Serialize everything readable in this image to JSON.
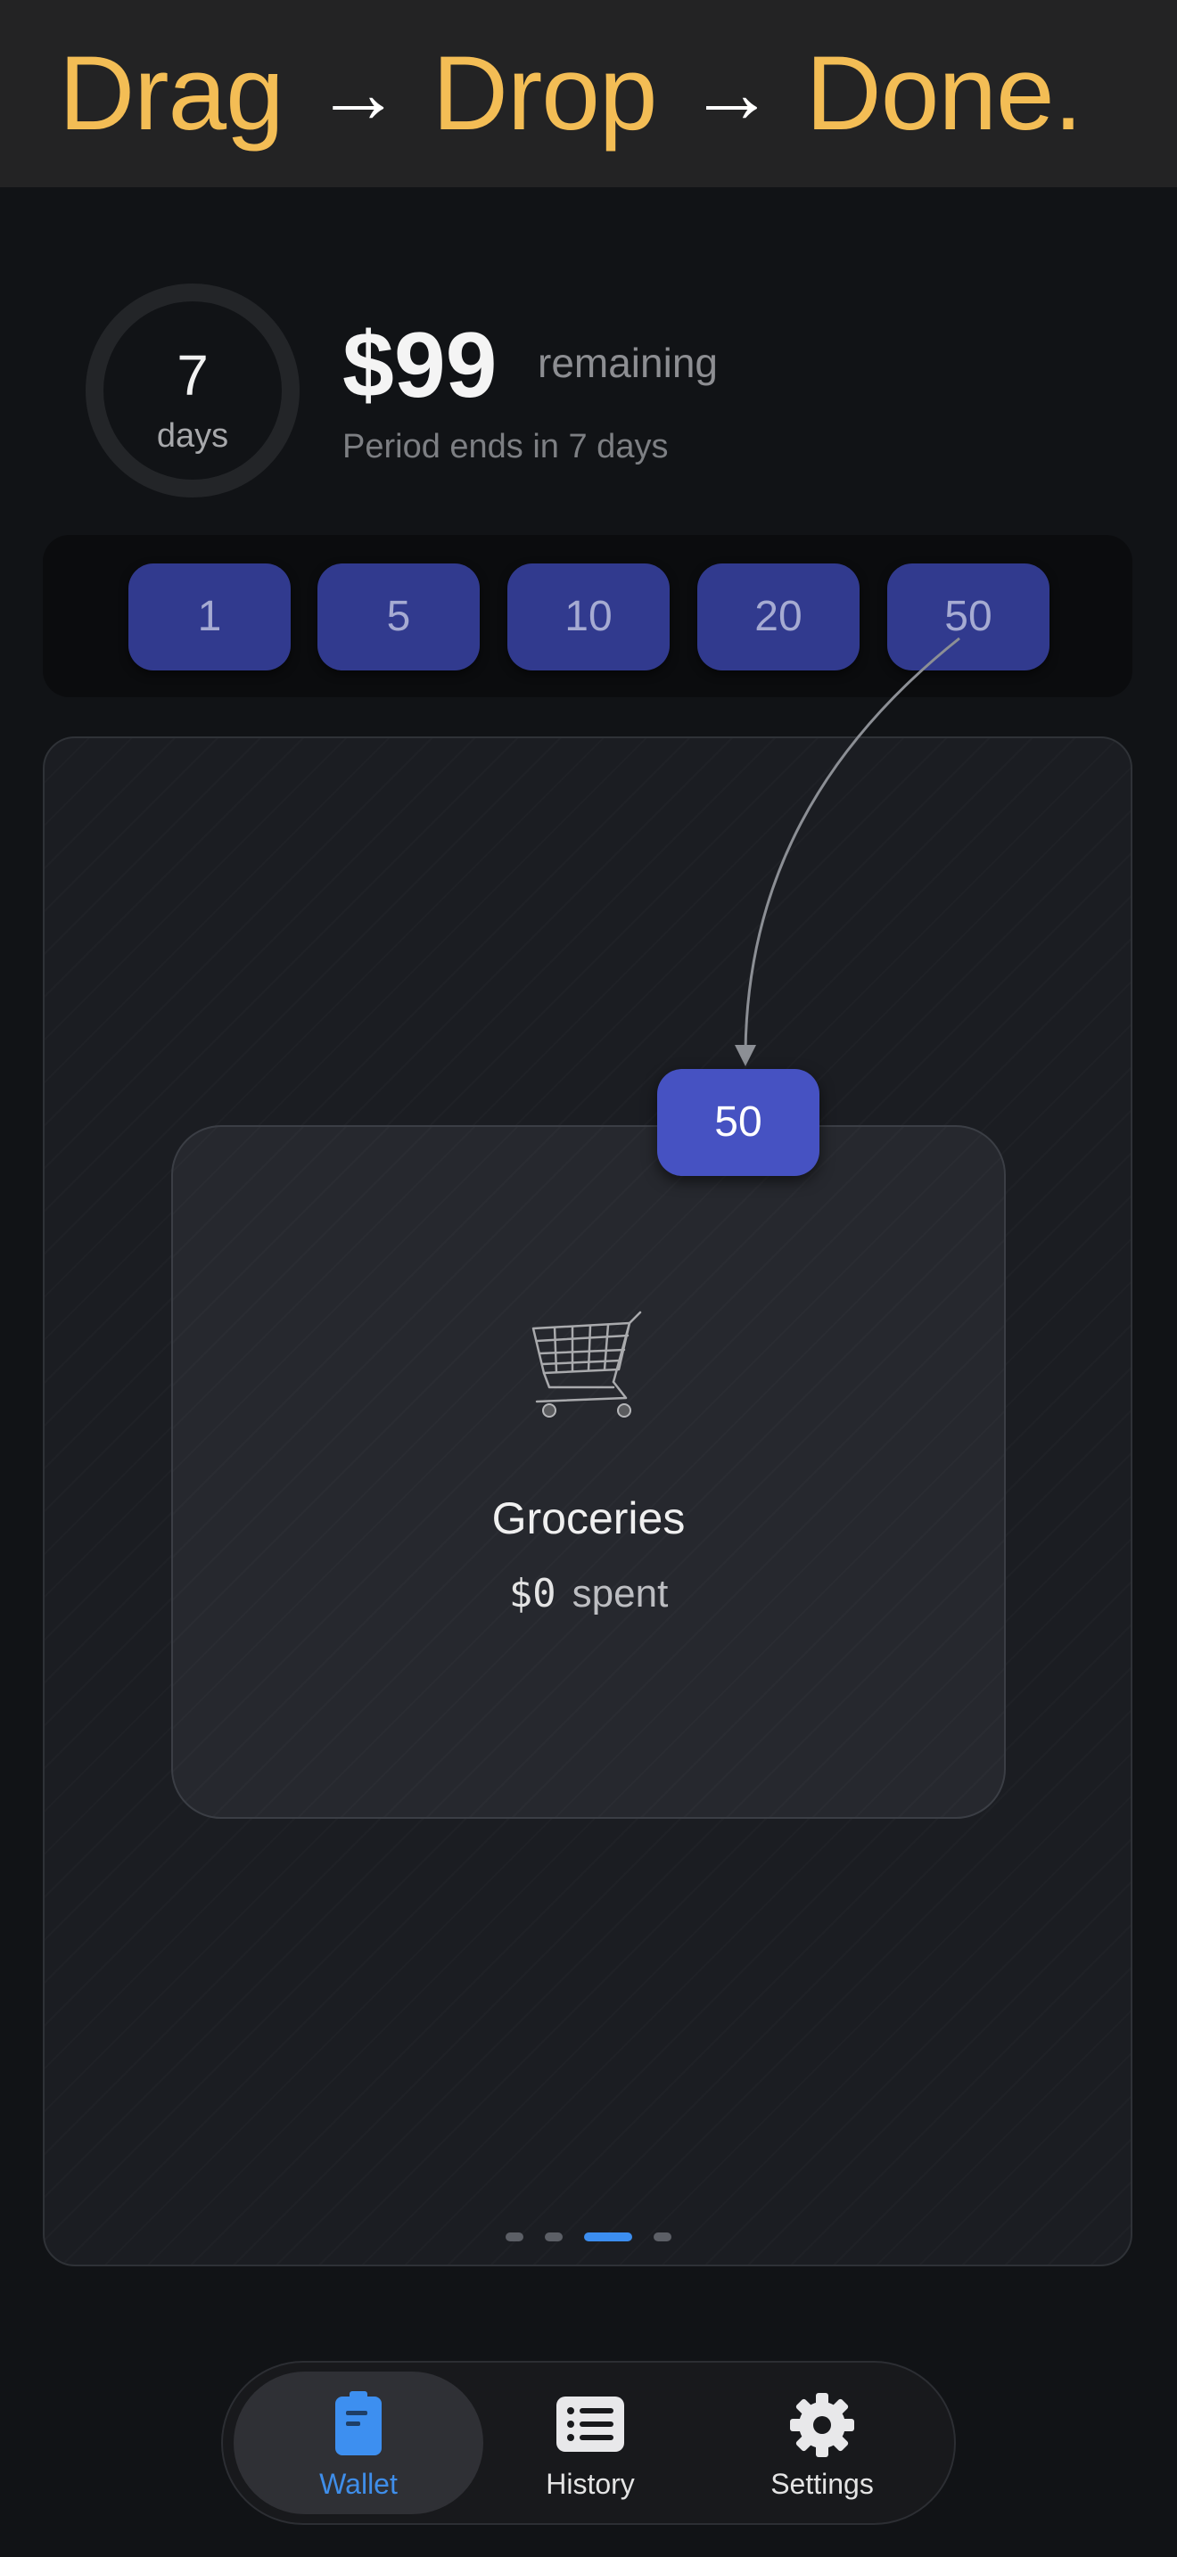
{
  "banner": {
    "word1": "Drag",
    "arrow1": "→",
    "word2": "Drop",
    "arrow2": "→",
    "word3": "Done."
  },
  "summary": {
    "days_value": "7",
    "days_unit": "days",
    "amount": "$99",
    "amount_suffix": "remaining",
    "period_text": "Period ends in 7 days"
  },
  "chips": [
    "1",
    "5",
    "10",
    "20",
    "50"
  ],
  "drag_chip": "50",
  "card": {
    "icon": "shopping-cart-icon",
    "name": "Groceries",
    "spent_value": "$0",
    "spent_label": "spent"
  },
  "carousel": {
    "page_count": 4,
    "active_index": 2
  },
  "tabs": [
    {
      "label": "Wallet",
      "icon": "wallet-icon",
      "active": true
    },
    {
      "label": "History",
      "icon": "list-icon",
      "active": false
    },
    {
      "label": "Settings",
      "icon": "gear-icon",
      "active": false
    }
  ],
  "colors": {
    "accent_yellow": "#f3bd55",
    "chip_blue": "#313a8e",
    "chip_active": "#4652c2",
    "tab_active": "#3f8eea"
  }
}
